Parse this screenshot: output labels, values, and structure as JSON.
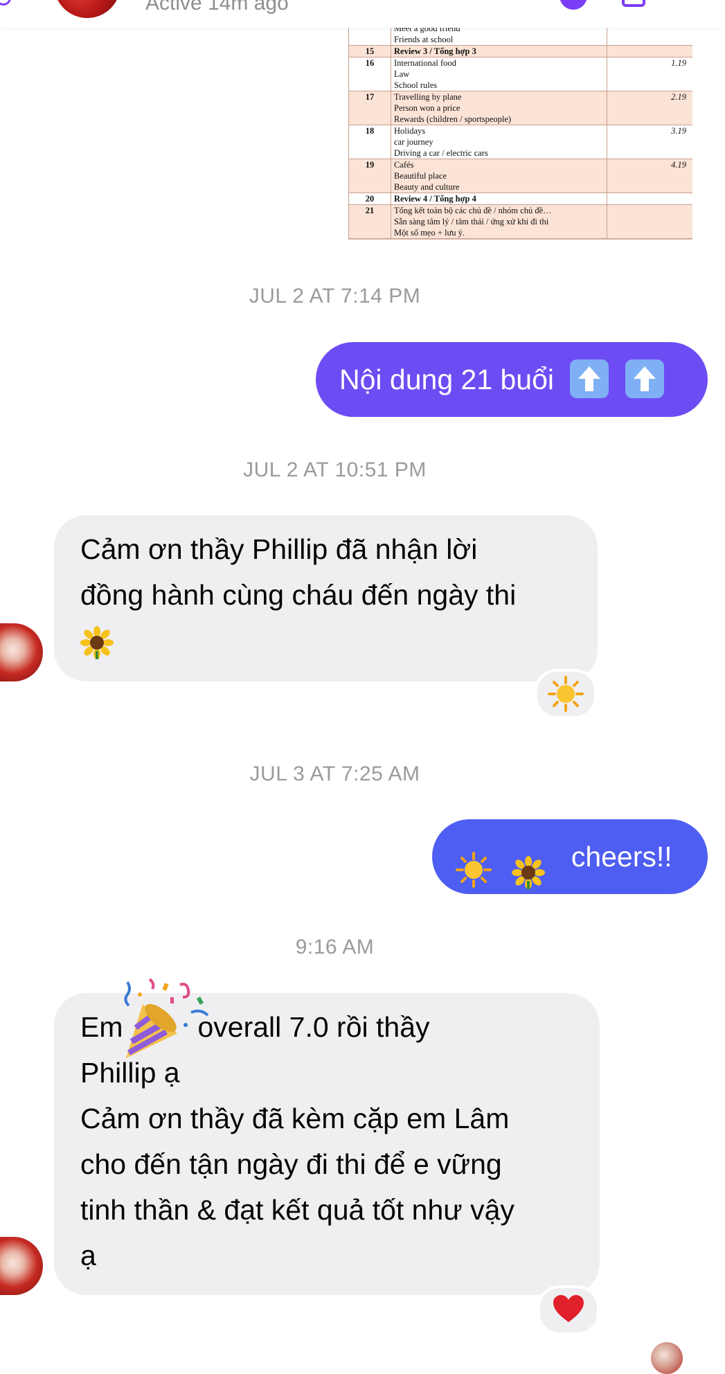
{
  "header": {
    "status": "Active 14m ago"
  },
  "attachment": {
    "rows": [
      {
        "num": "",
        "lines": [
          "Meet a good friend",
          "Friends at school"
        ],
        "code": "",
        "alt": false,
        "bold": false
      },
      {
        "num": "15",
        "lines": [
          "Review 3 / Tổng hợp 3"
        ],
        "code": "",
        "alt": true,
        "bold": true
      },
      {
        "num": "16",
        "lines": [
          "International food",
          "Law",
          "School rules"
        ],
        "code": "1.19",
        "alt": false,
        "bold": false
      },
      {
        "num": "17",
        "lines": [
          "Travelling by plane",
          "Person won a price",
          "Rewards (children / sportspeople)"
        ],
        "code": "2.19",
        "alt": true,
        "bold": false
      },
      {
        "num": "18",
        "lines": [
          "Holidays",
          "car journey",
          "Driving a car / electric cars"
        ],
        "code": "3.19",
        "alt": false,
        "bold": false
      },
      {
        "num": "19",
        "lines": [
          "Cafés",
          "Beautiful place",
          "Beauty and culture"
        ],
        "code": "4.19",
        "alt": true,
        "bold": false
      },
      {
        "num": "20",
        "lines": [
          "Review 4 / Tổng hợp 4"
        ],
        "code": "",
        "alt": false,
        "bold": true
      },
      {
        "num": "21",
        "lines": [
          "Tổng kết toàn bộ các chủ đề / nhóm chủ đề…",
          "Sẵn sàng tâm lý / tâm thái / ứng xử khi đi thi",
          "Một số mẹo + lưu ý."
        ],
        "code": "",
        "alt": true,
        "bold": false
      }
    ]
  },
  "messages": {
    "ts1": "JUL 2 AT 7:14 PM",
    "m1_text": "Nội dung 21 buổi",
    "ts2": "JUL 2 AT 10:51 PM",
    "m2_line1": "Cảm ơn thầy Phillip đã nhận lời",
    "m2_line2": "đồng hành cùng cháu đến ngày thi",
    "m2_reaction": "sun-emoji",
    "ts3": "JUL 3 AT 7:25 AM",
    "m3_text": "cheers!!",
    "ts4": "9:16 AM",
    "m4_line1a": "Em",
    "m4_line1b": "overall 7.0 rồi thầy",
    "m4_line2": "Phillip ạ",
    "m4_line3": "Cảm ơn thầy đã kèm cặp em Lâm",
    "m4_line4": "cho đến tận ngày đi thi để e vững",
    "m4_line5": "tinh thần & đạt kết quả tốt như vậy",
    "m4_line6": "ạ",
    "m4_reaction": "heart-emoji"
  },
  "colors": {
    "outgoing_purple": "#6d4cf4",
    "outgoing_blue": "#4e5ef2",
    "incoming_gray": "#efeff1",
    "timestamp_gray": "#9a9a9f",
    "heart_red": "#e0202a"
  }
}
